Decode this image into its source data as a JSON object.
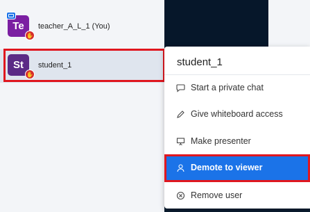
{
  "users": [
    {
      "initials": "Te",
      "name": "teacher_A_L_1 (You)",
      "avatar_color": "#7b1fa2",
      "role_icon": "presentation-screen-icon",
      "status_icon": "raised-hand-icon"
    },
    {
      "initials": "St",
      "name": "student_1",
      "avatar_color": "#5b2a86",
      "status_icon": "raised-hand-icon"
    }
  ],
  "menu": {
    "title": "student_1",
    "items": [
      {
        "label": "Start a private chat",
        "icon": "chat-bubble-icon"
      },
      {
        "label": "Give whiteboard access",
        "icon": "pencil-icon"
      },
      {
        "label": "Make presenter",
        "icon": "presentation-board-icon"
      },
      {
        "label": "Demote to viewer",
        "icon": "user-icon",
        "active": true
      },
      {
        "label": "Remove user",
        "icon": "remove-circle-icon"
      }
    ]
  },
  "colors": {
    "accent": "#1b73e8",
    "highlight": "#e0171f",
    "dark_panel": "#06172a"
  }
}
